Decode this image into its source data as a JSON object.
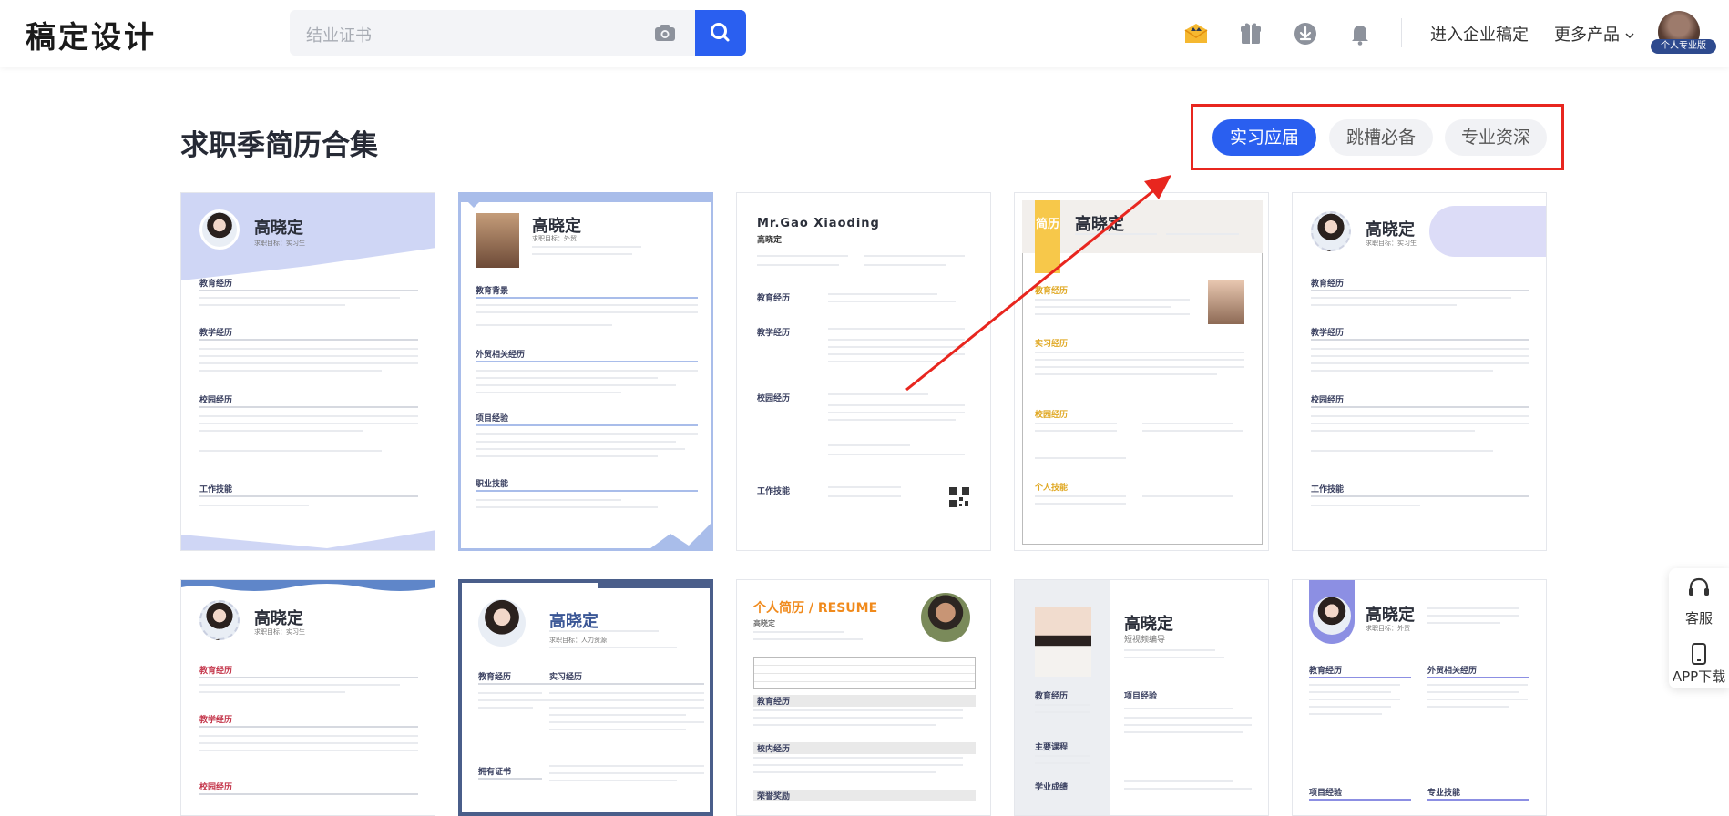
{
  "header": {
    "logo": "稿定设计",
    "search_placeholder": "结业证书",
    "enterprise_link": "进入企业稿定",
    "more_products": "更多产品",
    "avatar_badge": "个人专业版"
  },
  "section": {
    "title": "求职季简历合集",
    "tabs": [
      {
        "label": "实习应届",
        "active": true
      },
      {
        "label": "跳槽必备",
        "active": false
      },
      {
        "label": "专业资深",
        "active": false
      }
    ]
  },
  "cards_row1": [
    {
      "name": "高晓定",
      "sub": "求职目标：实习生",
      "sections": [
        "教育经历",
        "教学经历",
        "校园经历",
        "工作技能"
      ]
    },
    {
      "name": "高晓定",
      "sub": "求职目标：外贸",
      "sections": [
        "教育背景",
        "外贸相关经历",
        "项目经验",
        "职业技能"
      ]
    },
    {
      "name": "Mr.Gao Xiaoding",
      "sub": "高晓定",
      "sections": [
        "教育经历",
        "教学经历",
        "校园经历",
        "工作技能"
      ]
    },
    {
      "name": "高晓定",
      "sub": "简历",
      "sections": [
        "教育经历",
        "实习经历",
        "校园经历",
        "个人技能"
      ]
    },
    {
      "name": "高晓定",
      "sub": "求职目标：实习生",
      "sections": [
        "教育经历",
        "教学经历",
        "校园经历",
        "工作技能"
      ]
    }
  ],
  "cards_row2": [
    {
      "name": "高晓定",
      "sub": "求职目标：实习生",
      "sections": [
        "教育经历",
        "教学经历",
        "校园经历"
      ]
    },
    {
      "name": "高晓定",
      "sub": "求职目标：人力资源",
      "sections": [
        "教育经历",
        "实习经历",
        "拥有证书"
      ]
    },
    {
      "name": "个人简历 / RESUME",
      "sub": "高晓定",
      "sections": [
        "教育经历",
        "校内经历",
        "荣誉奖励"
      ]
    },
    {
      "name": "高晓定",
      "sub": "短视频编导",
      "sections": [
        "教育经历",
        "项目经验",
        "主要课程",
        "学业成绩"
      ]
    },
    {
      "name": "高晓定",
      "sub": "求职目标：外贸",
      "sections": [
        "教育经历",
        "外贸相关经历",
        "项目经验",
        "专业技能"
      ]
    }
  ],
  "side_tools": {
    "service": "客服",
    "app": "APP下载"
  }
}
